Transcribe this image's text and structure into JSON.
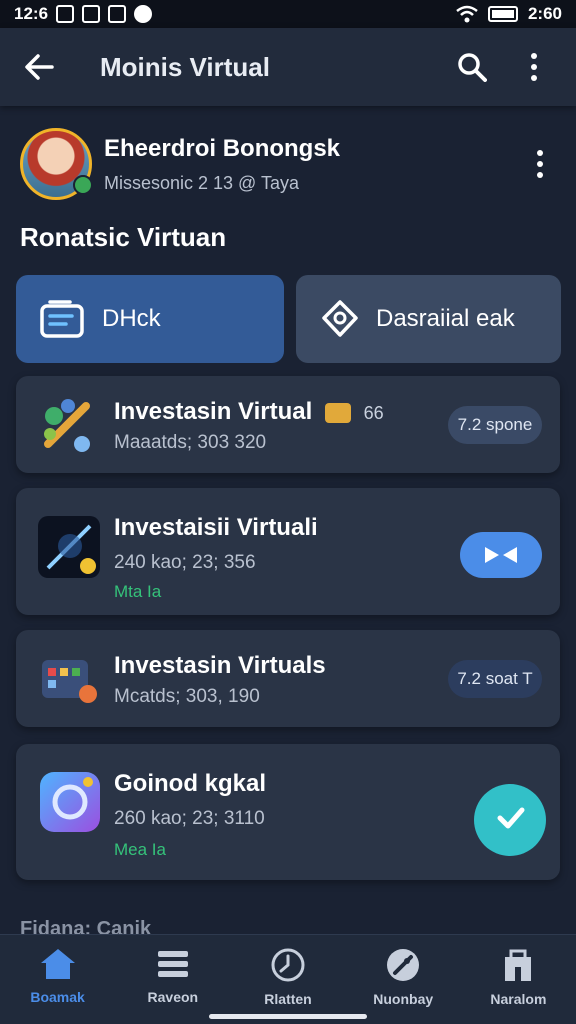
{
  "status_bar": {
    "time": "12:6",
    "battery_text": "2:60",
    "icons": [
      "mail-icon",
      "image-icon",
      "app-icon",
      "chat-icon",
      "wifi-icon",
      "battery-icon"
    ]
  },
  "app_bar": {
    "title": "Moinis Virtual",
    "back_icon": "arrow-left-icon",
    "search_icon": "search-icon",
    "more_icon": "more-vertical-icon"
  },
  "profile": {
    "name": "Eheerdroi Bonongsk",
    "subtitle": "Missesonic 2 13 @ Taya"
  },
  "section": {
    "title": "Ronatsic Virtuan"
  },
  "quick_actions": [
    {
      "label": "DHck",
      "icon": "document-icon"
    },
    {
      "label": "Dasraiial eak",
      "icon": "location-pin-icon"
    }
  ],
  "cards": [
    {
      "title": "Investasin Virtual",
      "extra": "66",
      "sub": "Maaatds; 303 320",
      "pill": "7.2 spone",
      "tag": ""
    },
    {
      "title": "Investaisii Virtuali",
      "sub": "240 kao; 23; 356",
      "tag": "Mta Ia",
      "action": "play"
    },
    {
      "title": "Investasin Virtuals",
      "sub": "Mcatds; 303, 190",
      "pill": "7.2 soat T",
      "tag": ""
    },
    {
      "title": "Goinod kgkal",
      "sub": "260 kao; 23; 3110",
      "tag": "Mea Ia",
      "action": "chat"
    }
  ],
  "peek_text": "Fidana: Canik",
  "bottom_nav": [
    {
      "label": "Boamak",
      "icon": "home-icon",
      "active": true
    },
    {
      "label": "Raveon",
      "icon": "list-icon",
      "active": false
    },
    {
      "label": "Rlatten",
      "icon": "clock-icon",
      "active": false
    },
    {
      "label": "Nuonbay",
      "icon": "rocket-icon",
      "active": false
    },
    {
      "label": "Naralom",
      "icon": "store-icon",
      "active": false
    }
  ],
  "colors": {
    "background": "#1a2233",
    "card": "#2a3446",
    "accent": "#4b8de8",
    "primary_button": "#335b97",
    "green": "#35c27a",
    "fab": "#32c0c8"
  }
}
